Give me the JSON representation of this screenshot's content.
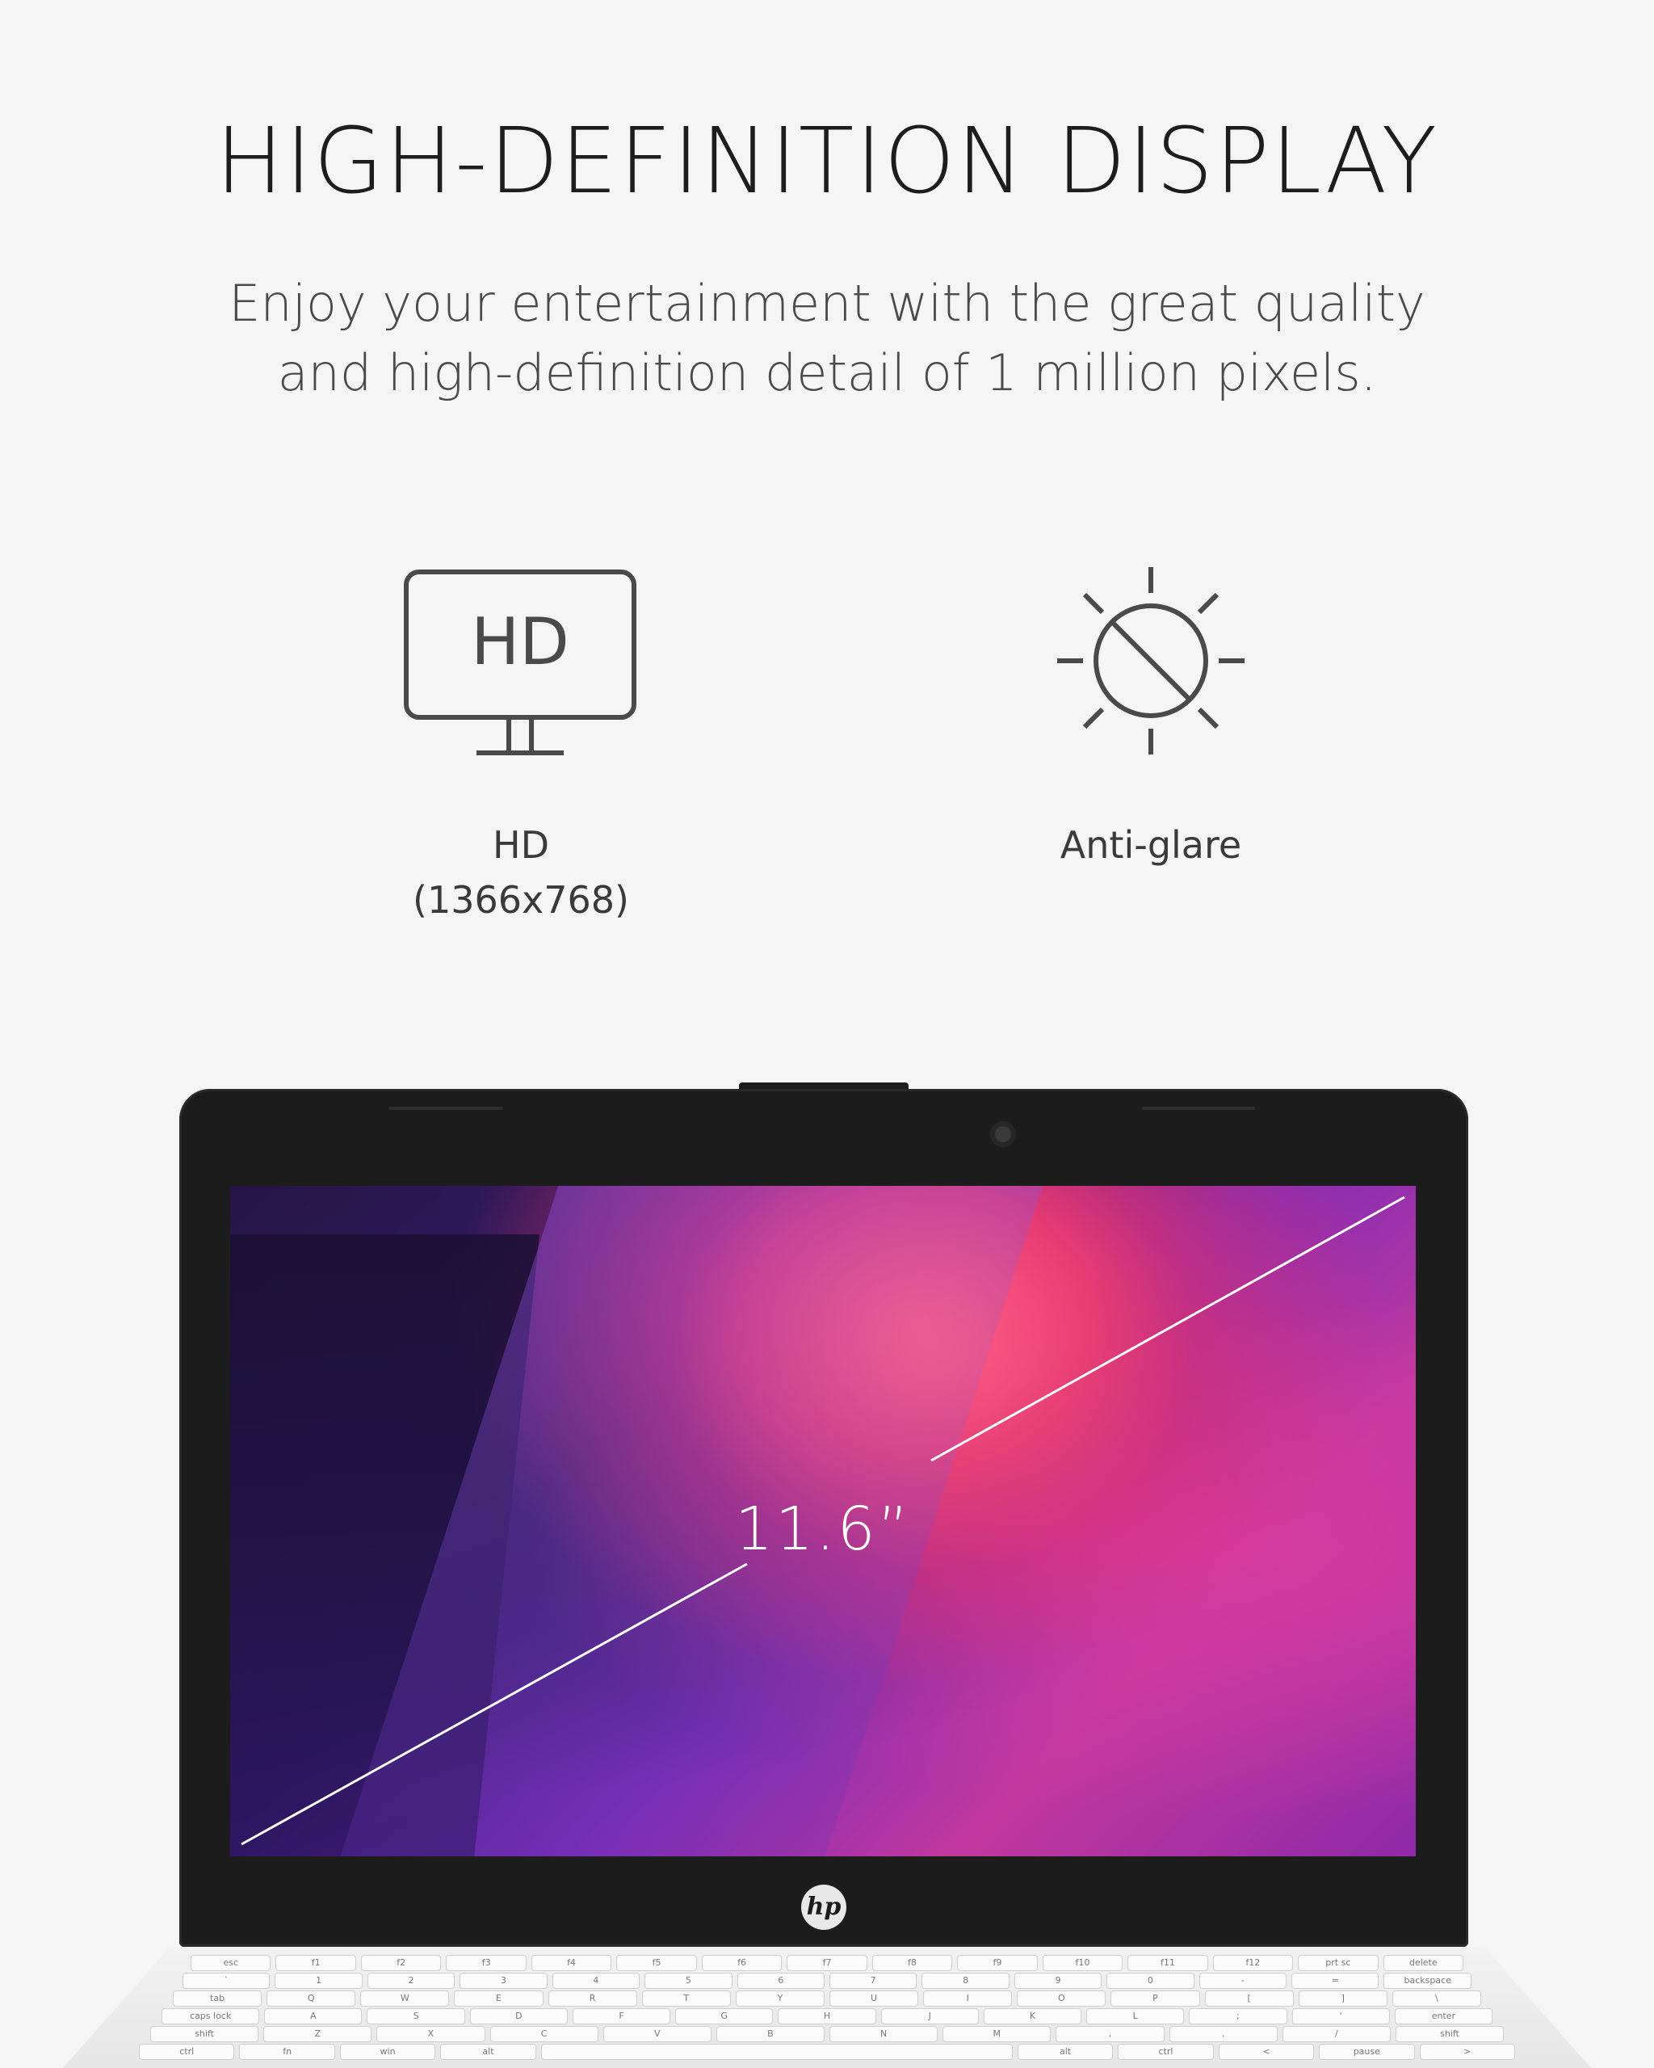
{
  "header": {
    "title": "HIGH-DEFINITION DISPLAY",
    "subtitle_line1": "Enjoy your entertainment with the great quality",
    "subtitle_line2": "and high-definition detail of 1 million pixels."
  },
  "features": [
    {
      "icon": "hd-monitor-icon",
      "label_line1": "HD",
      "label_line2": "(1366x768)",
      "icon_text": "HD"
    },
    {
      "icon": "anti-glare-sun-icon",
      "label_line1": "Anti-glare"
    }
  ],
  "laptop": {
    "screen_size": "11.6”",
    "logo_text": "hp"
  },
  "keyboard": {
    "row1": [
      "esc",
      "f1",
      "f2",
      "f3",
      "f4",
      "f5",
      "f6",
      "f7",
      "f8",
      "f9",
      "f10",
      "f11",
      "f12",
      "prt sc",
      "delete"
    ],
    "row2": [
      "`",
      "1",
      "2",
      "3",
      "4",
      "5",
      "6",
      "7",
      "8",
      "9",
      "0",
      "-",
      "=",
      "backspace"
    ],
    "row3": [
      "tab",
      "Q",
      "W",
      "E",
      "R",
      "T",
      "Y",
      "U",
      "I",
      "O",
      "P",
      "[",
      "]",
      "\\"
    ],
    "row4": [
      "caps lock",
      "A",
      "S",
      "D",
      "F",
      "G",
      "H",
      "J",
      "K",
      "L",
      ";",
      "'",
      "enter"
    ],
    "row5": [
      "shift",
      "Z",
      "X",
      "C",
      "V",
      "B",
      "N",
      "M",
      ",",
      ".",
      "/",
      "shift"
    ],
    "row6": [
      "ctrl",
      "fn",
      "win",
      "alt",
      "",
      "alt",
      "ctrl",
      "<",
      "pause",
      ">"
    ]
  },
  "colors": {
    "background": "#f5f5f5",
    "text": "#2b2b2b",
    "bezel": "#1c1c1c"
  }
}
